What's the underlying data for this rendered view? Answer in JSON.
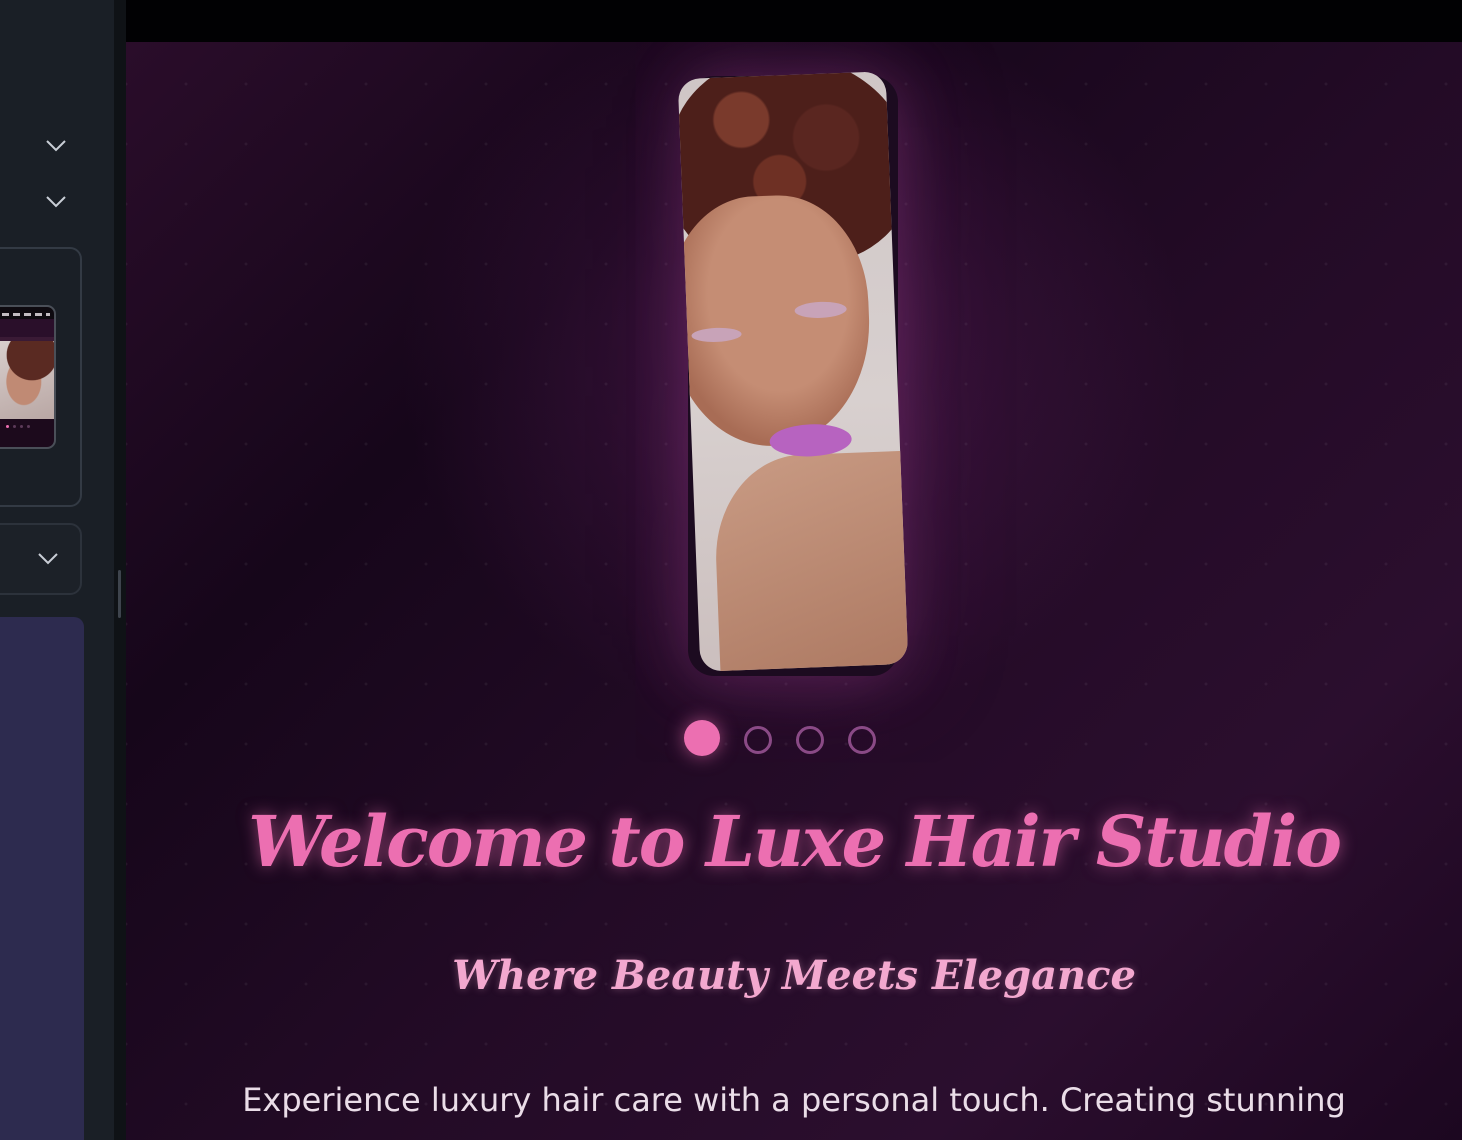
{
  "sidebar": {
    "icons": {
      "accordion_1": "chevron-down-icon",
      "accordion_2": "chevron-down-icon",
      "accordion_3": "chevron-down-icon"
    }
  },
  "site": {
    "hero": {
      "title": "Welcome to Luxe Hair Studio",
      "subtitle": "Where Beauty Meets Elegance",
      "description": "Experience luxury hair care with a personal touch. Creating stunning hairstyles that make you feel confident and beautiful.",
      "carousel": {
        "slide_count": 4,
        "active_index": 0
      }
    }
  },
  "colors": {
    "accent_pink": "#ec6fb1",
    "subtitle_pink": "#f3a8cf",
    "hero_background": "#1d0820",
    "panel_background": "#1a1f26"
  }
}
